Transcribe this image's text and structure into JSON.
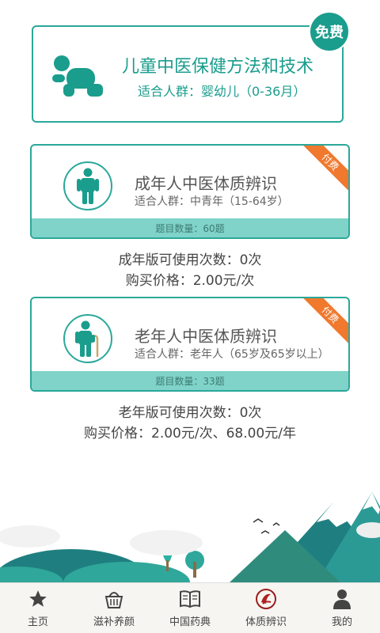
{
  "free_card": {
    "title": "儿童中医保健方法和技术",
    "audience": "适合人群：婴幼儿（0-36月）",
    "badge": "免费",
    "icon": "crawling-baby-icon"
  },
  "adult_card": {
    "title": "成年人中医体质辨识",
    "audience": "适合人群：中青年（15-64岁）",
    "question_count": "题目数量：60题",
    "ribbon": "付费",
    "icon": "adult-person-icon",
    "uses_left": "成年版可使用次数：0次",
    "price": "购买价格：2.00元/次"
  },
  "senior_card": {
    "title": "老年人中医体质辨识",
    "audience": "适合人群：老年人（65岁及65岁以上）",
    "question_count": "题目数量：33题",
    "ribbon": "付费",
    "icon": "elderly-person-icon",
    "uses_left": "老年版可使用次数：0次",
    "price": "购买价格：2.00元/次、68.00元/年"
  },
  "bottom_nav": {
    "items": [
      {
        "label": "主页",
        "icon": "star-icon"
      },
      {
        "label": "滋补养颜",
        "icon": "basket-icon"
      },
      {
        "label": "中国药典",
        "icon": "book-icon"
      },
      {
        "label": "体质辨识",
        "icon": "constitution-logo-icon",
        "active": true
      },
      {
        "label": "我的",
        "icon": "user-icon"
      }
    ]
  },
  "colors": {
    "teal": "#1a9d8c",
    "teal_light": "#7fd3c9",
    "ribbon": "#f0792e"
  }
}
